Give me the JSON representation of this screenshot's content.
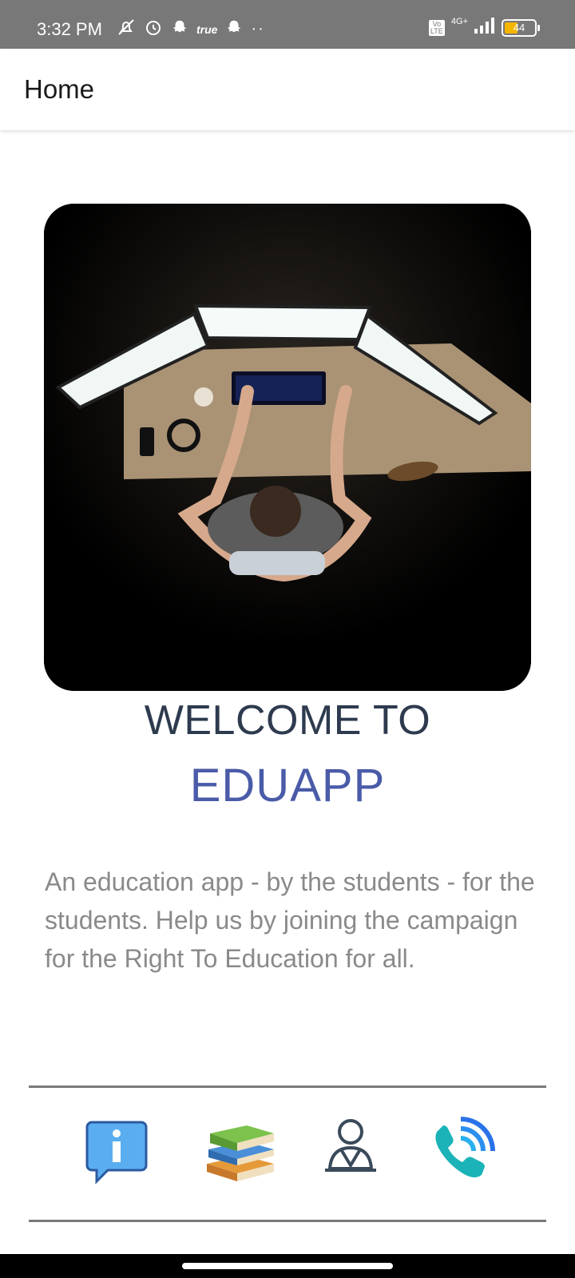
{
  "status_bar": {
    "time": "3:32 PM",
    "carrier_text": "true",
    "network": "4G+",
    "volte": "Vo LTE",
    "battery_level": "44",
    "icons": [
      "mute-icon",
      "alarm-icon",
      "snapchat-icon",
      "snapchat-icon",
      "more-dots-icon",
      "signal-icon",
      "battery-icon"
    ]
  },
  "appbar": {
    "title": "Home"
  },
  "hero": {
    "image_alt": "person at desk with three monitors"
  },
  "welcome": {
    "line1": "WELCOME TO",
    "line2": "EDUAPP"
  },
  "description": "An education app - by the students - for the students. Help us by joining the campaign for the Right To Education for all.",
  "nav": {
    "items": [
      {
        "icon": "info-bubble-icon"
      },
      {
        "icon": "books-icon"
      },
      {
        "icon": "profile-icon"
      },
      {
        "icon": "phone-call-icon"
      }
    ]
  },
  "colors": {
    "status_bar": "#787878",
    "welcome_text": "#2e3a4e",
    "app_name": "#4a5ba8",
    "description_text": "#8a8a8a",
    "divider": "#7a7a7a",
    "battery_fill": "#f5b400"
  }
}
